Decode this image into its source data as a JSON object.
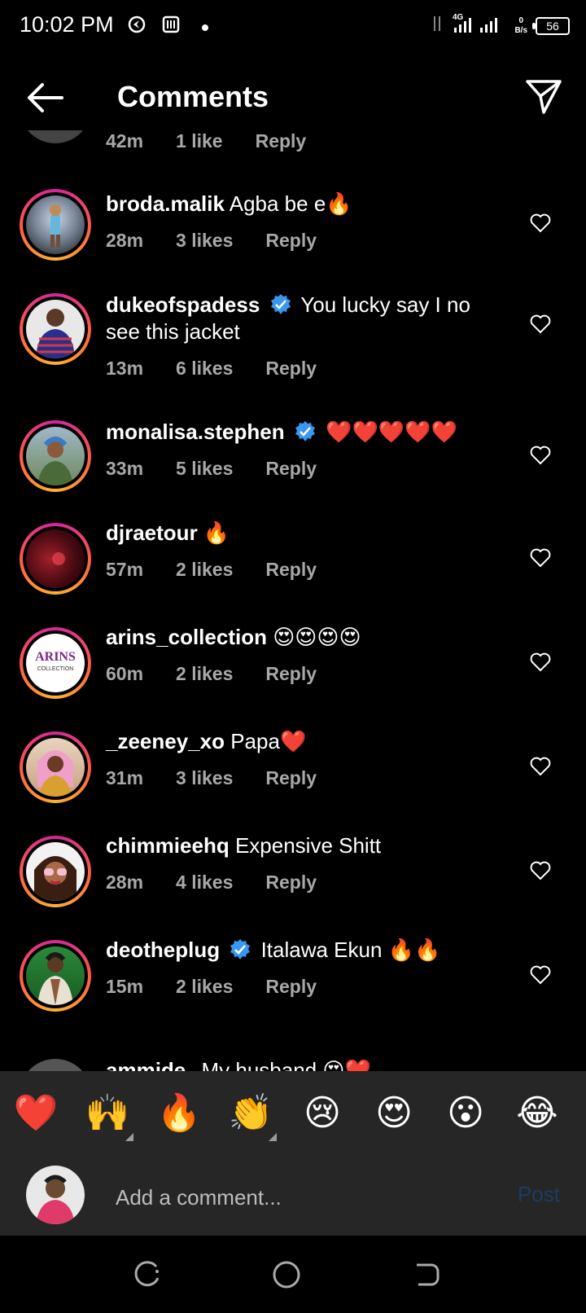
{
  "status_bar": {
    "time": "10:02 PM",
    "network": "4G",
    "speed_value": "0",
    "speed_unit": "B/s",
    "battery": "56"
  },
  "header": {
    "title": "Comments"
  },
  "partial_top_comment": {
    "time": "42m",
    "likes": "1 like",
    "reply": "Reply"
  },
  "comments": [
    {
      "username": "broda.malik",
      "verified": false,
      "text": "Agba be e🔥",
      "time": "28m",
      "likes": "3 likes",
      "reply": "Reply"
    },
    {
      "username": "dukeofspadess",
      "verified": true,
      "text": "You lucky say I no see this jacket",
      "time": "13m",
      "likes": "6 likes",
      "reply": "Reply"
    },
    {
      "username": "monalisa.stephen",
      "verified": true,
      "text": "❤️❤️❤️❤️❤️",
      "time": "33m",
      "likes": "5 likes",
      "reply": "Reply"
    },
    {
      "username": "djraetour",
      "verified": false,
      "text": "🔥",
      "time": "57m",
      "likes": "2 likes",
      "reply": "Reply"
    },
    {
      "username": "arins_collection",
      "verified": false,
      "text": "😍😍😍😍",
      "time": "60m",
      "likes": "2 likes",
      "reply": "Reply",
      "avatar_logo": "ARINS",
      "avatar_sub": "COLLECTION"
    },
    {
      "username": "_zeeney_xo",
      "verified": false,
      "text": "Papa❤️",
      "time": "31m",
      "likes": "3 likes",
      "reply": "Reply"
    },
    {
      "username": "chimmieehq",
      "verified": false,
      "text": "Expensive Shitt",
      "time": "28m",
      "likes": "4 likes",
      "reply": "Reply"
    },
    {
      "username": "deotheplug",
      "verified": true,
      "text": "Italawa Ekun 🔥🔥",
      "time": "15m",
      "likes": "2 likes",
      "reply": "Reply"
    }
  ],
  "partial_bottom_comment": {
    "username": "ammide",
    "text": "My husband 😍❤️"
  },
  "emoji_bar": [
    "❤️",
    "🙌",
    "🔥",
    "👏",
    "😢",
    "😍",
    "😮",
    "😂"
  ],
  "composer": {
    "placeholder": "Add a comment...",
    "post_label": "Post"
  },
  "colors": {
    "background": "#000000",
    "secondary_text": "#a8a8a8",
    "bar_bg": "#262626",
    "verified_blue": "#3897f0",
    "post_disabled": "#1b3c63"
  }
}
